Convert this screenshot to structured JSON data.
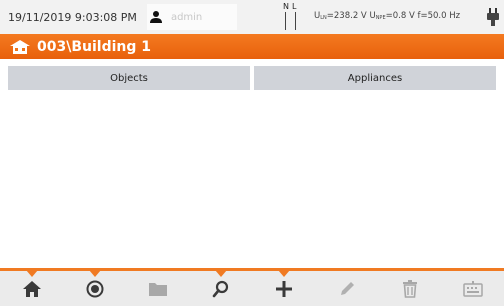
{
  "status_bar": {
    "datetime": "19/11/2019 9:03:08 PM",
    "user_icon": "user-icon",
    "user_name": "admin",
    "nl_n": "N",
    "nl_l": "L",
    "measurement_parts": {
      "uln_label": "U",
      "uln_sub": "LN",
      "uln_value": "=238.2 V",
      "upe_label": "U",
      "upe_sub": "NPE",
      "upe_value": "=0.8 V",
      "freq": "f=50.0 Hz"
    },
    "plug_icon": "plug-icon"
  },
  "title_bar": {
    "icon": "building-icon",
    "title": "003\\Building 1"
  },
  "tabs": [
    {
      "label": "Objects"
    },
    {
      "label": "Appliances"
    }
  ],
  "toolbar": {
    "accent": "#f07a22",
    "buttons": [
      {
        "icon": "home-icon",
        "notch": true,
        "enabled": true
      },
      {
        "icon": "record-icon",
        "notch": true,
        "enabled": true
      },
      {
        "icon": "folder-icon",
        "notch": false,
        "enabled": false
      },
      {
        "icon": "search-icon",
        "notch": true,
        "enabled": true
      },
      {
        "icon": "plus-icon",
        "notch": true,
        "enabled": true
      },
      {
        "icon": "pencil-icon",
        "notch": false,
        "enabled": false
      },
      {
        "icon": "trash-icon",
        "notch": false,
        "enabled": false
      },
      {
        "icon": "keyboard-icon",
        "notch": false,
        "enabled": false
      }
    ]
  }
}
